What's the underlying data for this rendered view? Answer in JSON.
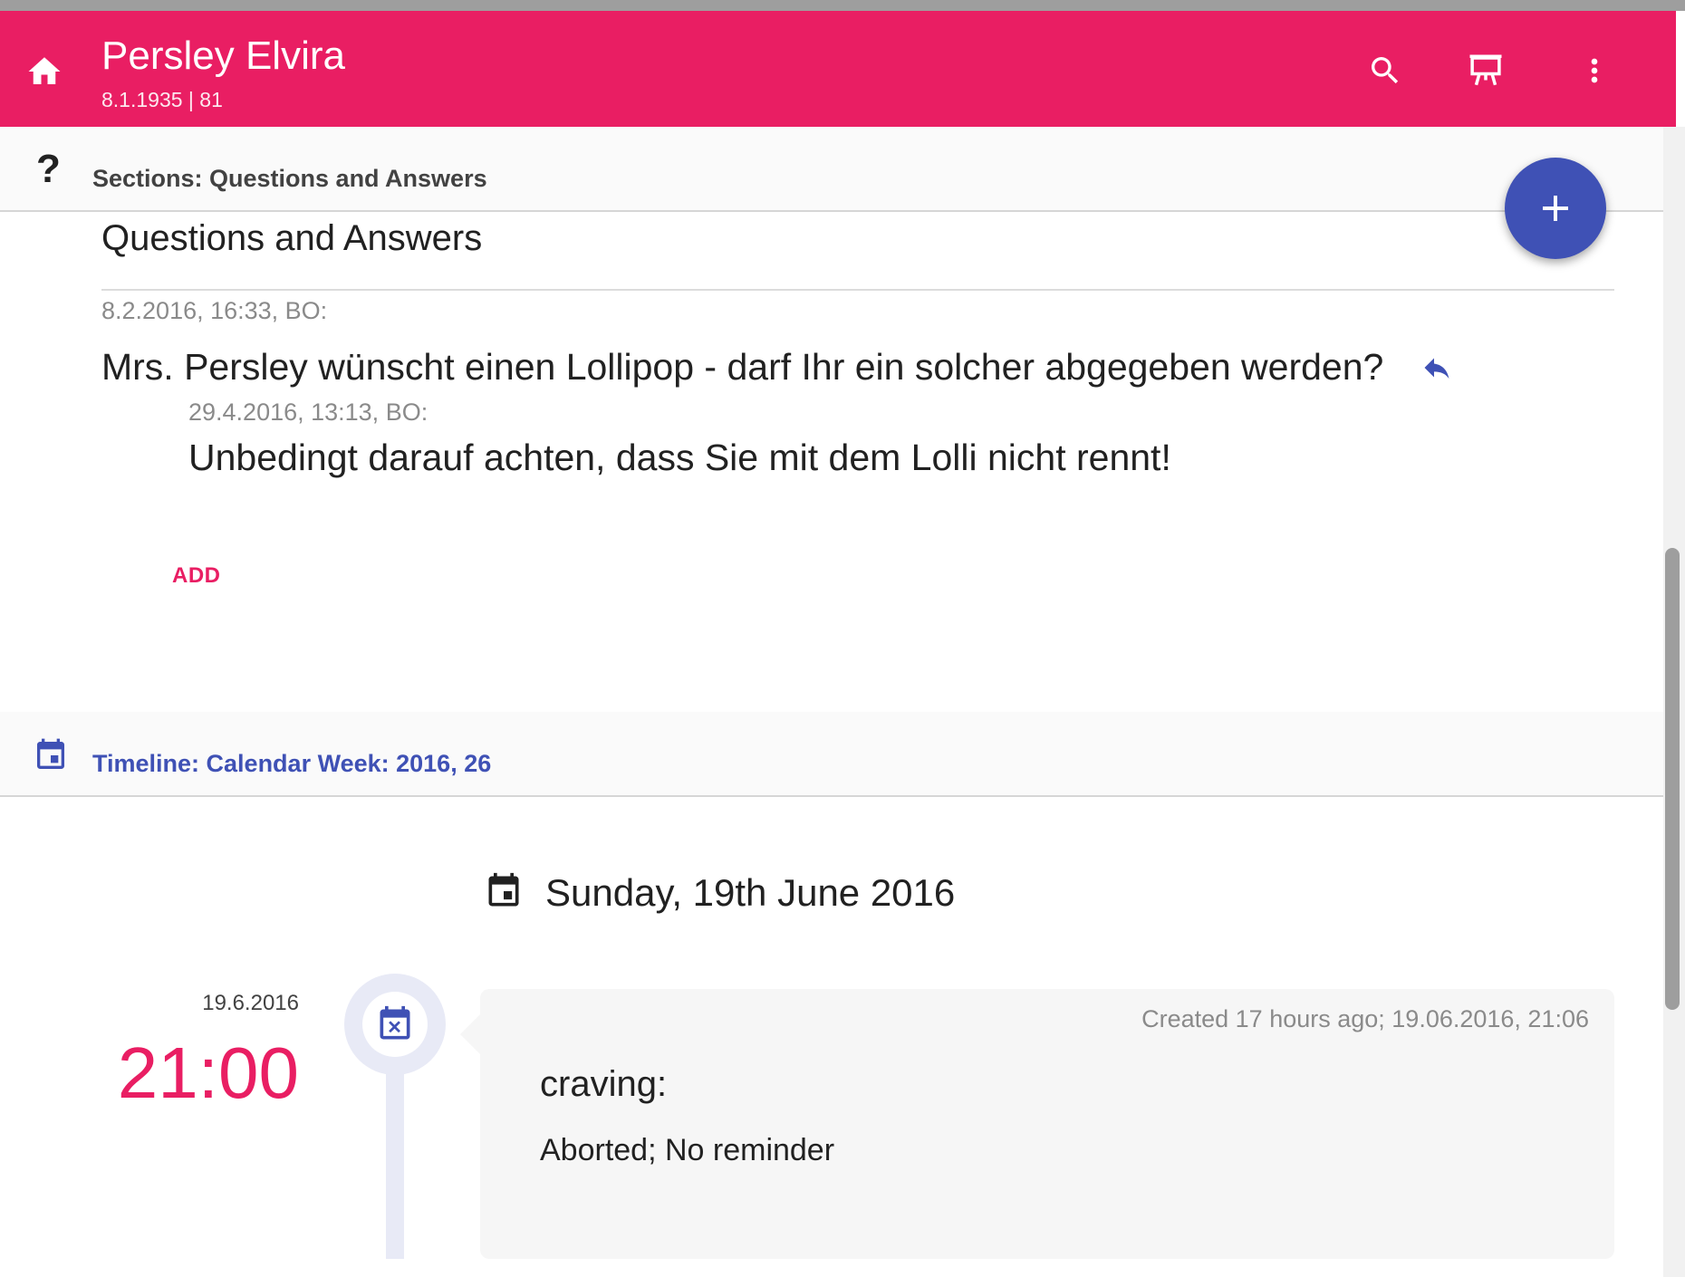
{
  "header": {
    "title": "Persley Elvira",
    "subtitle": "8.1.1935 | 81",
    "bg_color": "#e91e63",
    "icons": [
      "home-icon",
      "search-icon",
      "presentation-icon",
      "more-vert-icon"
    ]
  },
  "qa_section": {
    "icon_glyph": "?",
    "header_label": "Sections: Questions and Answers",
    "title": "Questions and Answers",
    "question_meta": "8.2.2016, 16:33, BO:",
    "question_text": "Mrs. Persley wünscht einen Lollipop - darf Ihr ein solcher abgegeben werden?",
    "answer_meta": "29.4.2016, 13:13, BO:",
    "answer_text": "Unbedingt darauf achten, dass Sie mit dem Lolli nicht rennt!",
    "add_label": "ADD"
  },
  "fab": {
    "icon": "add-icon",
    "color": "#3f51b5"
  },
  "timeline": {
    "header_prefix": "Timeline: Calendar Week: ",
    "header_week": "2016, 26",
    "accent_color": "#3f51b5",
    "day_title": "Sunday, 19th June 2016",
    "event": {
      "date": "19.6.2016",
      "time": "21:00",
      "created": "Created 17 hours ago; 19.06.2016, 21:06",
      "title": "craving:",
      "status": "Aborted; No reminder"
    }
  }
}
